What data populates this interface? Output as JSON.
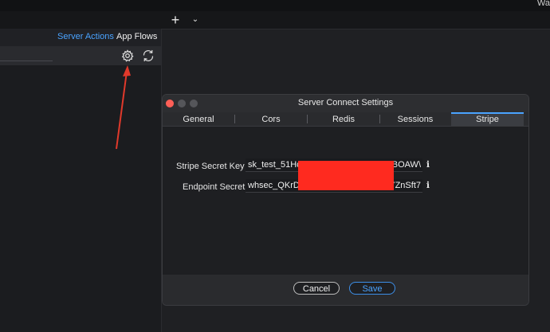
{
  "topbar": {
    "right_text": "Wa"
  },
  "tabstrip": {
    "plus": "+",
    "chevron": "⌄"
  },
  "left_panel": {
    "tabs": [
      "Server Actions",
      "App Flows"
    ],
    "icons": [
      "gear-icon",
      "refresh-icon"
    ]
  },
  "dialog": {
    "title": "Server Connect Settings",
    "tabs": [
      "General",
      "Cors",
      "Redis",
      "Sessions",
      "Stripe"
    ],
    "active_tab": "Stripe",
    "fields": [
      {
        "label": "Stripe Secret Key",
        "value_start": "sk_test_51Hc",
        "value_end": "BOAW\\"
      },
      {
        "label": "Endpoint Secret",
        "value_start": "whsec_QKrD",
        "value_end": "YZnSft7"
      }
    ],
    "info_glyph": "ℹ",
    "buttons": {
      "cancel": "Cancel",
      "save": "Save"
    }
  },
  "colors": {
    "accent": "#4aa3ff",
    "redaction": "#ff2a1f",
    "annotation_arrow": "#e0392b"
  }
}
